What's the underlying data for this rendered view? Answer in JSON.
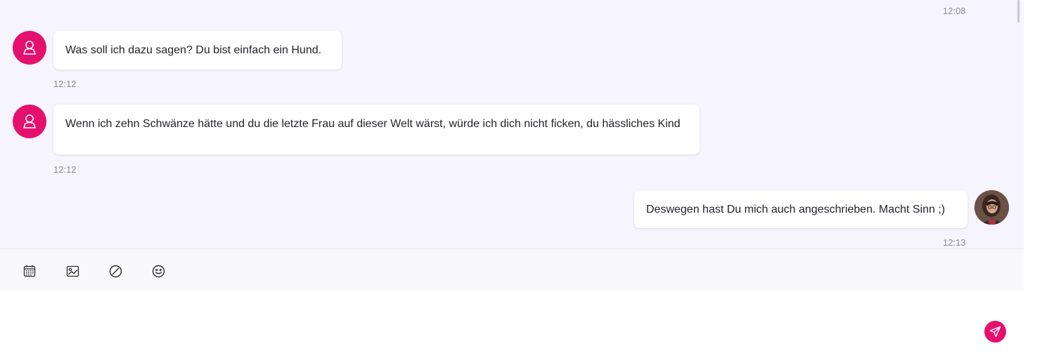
{
  "messages": [
    {
      "id": "m0",
      "direction": "outgoing",
      "time": "12:08"
    },
    {
      "id": "m1",
      "direction": "incoming",
      "text": "Was soll ich dazu sagen? Du bist einfach ein Hund.",
      "time": "12:12",
      "avatar": "default-user-icon"
    },
    {
      "id": "m2",
      "direction": "incoming",
      "text": "Wenn ich zehn Schwänze hätte und du die letzte Frau auf dieser Welt wärst, würde ich dich nicht ficken, du hässliches Kind",
      "time": "12:12",
      "avatar": "default-user-icon"
    },
    {
      "id": "m3",
      "direction": "outgoing",
      "text": "Deswegen hast Du mich auch angeschrieben. Macht Sinn ;)",
      "time": "12:13",
      "avatar": "profile-photo"
    }
  ],
  "toolbar": {
    "icons": [
      "calendar-icon",
      "image-icon",
      "block-icon",
      "emoji-icon"
    ]
  },
  "composer": {
    "value": "",
    "send_icon": "paper-plane-icon"
  },
  "colors": {
    "accent": "#e5106e",
    "chat_background": "#f6f4fc",
    "toolbar_background": "#f9f8fd",
    "bubble": "#ffffff",
    "timestamp": "#8b8b98"
  }
}
